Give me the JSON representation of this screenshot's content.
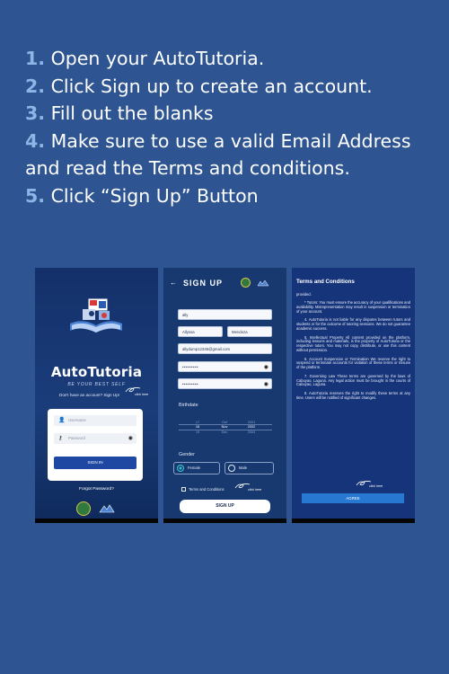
{
  "instructions": [
    {
      "num": "1.",
      "text": "Open your AutoTutoria."
    },
    {
      "num": "2.",
      "text": "Click Sign up to create an account."
    },
    {
      "num": "3.",
      "text": "Fill out the blanks"
    },
    {
      "num": "4.",
      "text": "Make sure to use a valid Email Address and read the Terms and conditions."
    },
    {
      "num": "5.",
      "text": "Click “Sign Up” Button"
    }
  ],
  "screen_login": {
    "brand": "AutoTutoria",
    "tagline": "BE YOUR BEST SELF",
    "signup_prompt": "Don't have an account? Sign Up!",
    "click_hint": "click here",
    "username_placeholder": "Username",
    "password_placeholder": "Password",
    "signin_label": "SIGN IN",
    "forgot_label": "Forgot Password?"
  },
  "screen_signup": {
    "back_icon": "←",
    "title": "SIGN UP",
    "username_value": "ally",
    "first_name_value": "Allyssa",
    "last_name_value": "Mendoza",
    "email_value": "allydump12345@gmail.com",
    "password_mask": "•••••••••",
    "confirm_mask": "•••••••••",
    "birthdate_label": "Birthdate",
    "date_wheel": {
      "days": [
        "17",
        "18",
        "19"
      ],
      "months": [
        "Oct",
        "Nov",
        "Dec"
      ],
      "years": [
        "2001",
        "2002",
        "2003"
      ]
    },
    "gender_label": "Gender",
    "gender_female": "Female",
    "gender_male": "Male",
    "terms_label": "Terms and Conditions",
    "click_hint": "click here",
    "signup_label": "SIGN UP"
  },
  "screen_terms": {
    "title": "Terms and Conditions",
    "paragraphs": [
      "provided.",
      "* Tutors: You must ensure the accuracy of your qualifications and availability. Misrepresentation may result in suspension or termination of your account.",
      "4. AutoTutoria is not liable for any disputes between tutors and students or for the outcome of tutoring sessions. We do not guarantee academic success.",
      "5. Intellectual Property All content provided on the platform, including lessons and materials, is the property of AutoTutoria or the respective tutors. You may not copy, distribute, or use this content without permission.",
      "6. Account Suspension or Termination We reserve the right to suspend or terminate accounts for violation of these terms or misuse of the platform.",
      "7. Governing Law These terms are governed by the laws of Cabuyao, Laguna. Any legal action must be brought in the courts of Cabuyao, Laguna.",
      "8. AutoTutoria reserves the right to modify these terms at any time. Users will be notified of significant changes."
    ],
    "agree_label": "AGREE",
    "click_hint": "click here"
  }
}
